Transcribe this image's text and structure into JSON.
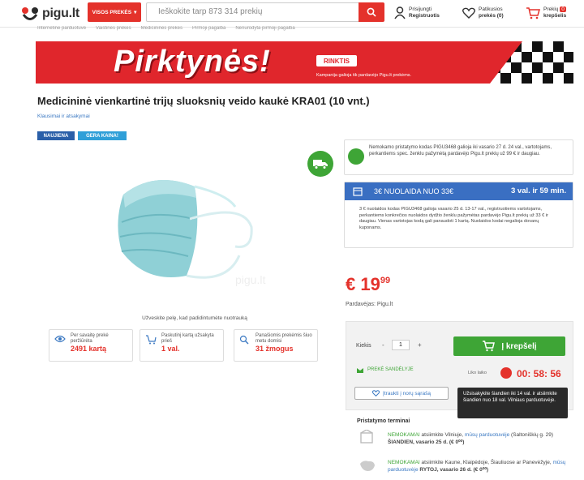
{
  "header": {
    "logo": "pigu.lt",
    "categories_label": "VISOS PREKĖS",
    "search_placeholder": "Ieškokite tarp 873 314 prekių",
    "login_top": "Prisijungti",
    "login_bottom": "Registruotis",
    "wishlist_top": "Patikusios",
    "wishlist_bottom": "prekės (0)",
    "cart_top": "Prekių",
    "cart_badge": "0",
    "cart_bottom": "krepšelis"
  },
  "breadcrumb": [
    "Internetinė parduotuvė",
    "Vaistinės prekės",
    "Medicininės prekės",
    "Pirmoji pagalba",
    "Nenurodyta pirmoji pagalba"
  ],
  "banner": {
    "title": "Pirktynės!",
    "tag": "RINKTIS",
    "subtitle": "Kampanija galioja tik pardavėjo Pigu.lt prekėms."
  },
  "product": {
    "title": "Medicininė vienkartinė trijų sluoksnių veido kaukė KRA01 (10 vnt.)",
    "questions_link": "Klausimai ir atsakymai",
    "badges": [
      {
        "label": "NAUJIENA",
        "color": "#2a5fa8"
      },
      {
        "label": "GERA KAINA!",
        "color": "#2f9fd8"
      }
    ],
    "watermark": "pigu.lt",
    "zoom_hint": "Užveskite pelę, kad padidintumėte nuotrauką"
  },
  "stats": [
    {
      "text": "Per savaitę prekė peržiūrėta",
      "value": "2491 kartą"
    },
    {
      "text": "Paskutinį kartą užsakyta prieš",
      "value": "1 val."
    },
    {
      "text": "Panašiomis prekėmis šiuo metu domisi",
      "value": "31 žmogus"
    }
  ],
  "promo": {
    "text": "Nemokamo pristatymo kodas PIGU3468 galioja iki vasario 27 d. 24 val., vartotojams, perkantiems spec. ženklu pažymėtą pardavėjo Pigu.lt prekių už 99 € ir daugiau."
  },
  "discount": {
    "label": "3€ NUOLAIDA NUO 33€",
    "time_left": "3 val. ir 59 min.",
    "text": "3 € nuolaidos kodas PIGU3468 galioja vasario 25 d. 13-17 val., registruotiems vartotojams, perkantiems konkrečios nuolaidos dydžio ženklu pažymėtas pardavėjo Pigu.lt prekių už 33 € ir daugiau. Vienas vartotojas kodą gali panaudoti 1 kartą. Nuolaidos kodai negalioja dovanų kuponams."
  },
  "price": {
    "main": "€ 19",
    "cents": "99",
    "seller": "Pardavėjas: Pigu.lt"
  },
  "buy": {
    "qty_label": "Kiekis",
    "qty_value": "1",
    "minus": "-",
    "plus": "+",
    "cart_button": "Į krepšelį",
    "stock": "PREKĖ SANDĖLYJE",
    "timer_label": "Liko laiko",
    "timer": "00: 58: 56",
    "wishlist_button": "Įtraukti į norų sąrašą"
  },
  "tooltip": "Užsisakykite šiandien iki 14 val. ir atsiimkite šiandien nuo 18 val. Vilniaus parduotuvėje.",
  "delivery": {
    "title": "Pristatymo terminai",
    "row1": {
      "free": "NEMOKAMAI",
      "text": "atsiimkite Vilniuje,",
      "link": "mūsų parduotuvėje",
      "addr": "(Saltoniškių g. 29)",
      "when": "ŠIANDIEN, vasario 25 d. (€ 0⁰⁰)"
    },
    "row2": {
      "free": "NEMOKAMAI",
      "text": "atsiimkite Kaune, Klaipėdoje, Šiauliuose ar Panevėžyje,",
      "link": "mūsų parduotuvėje",
      "when": "RYTOJ, vasario 26 d. (€ 0⁰⁰)"
    }
  }
}
